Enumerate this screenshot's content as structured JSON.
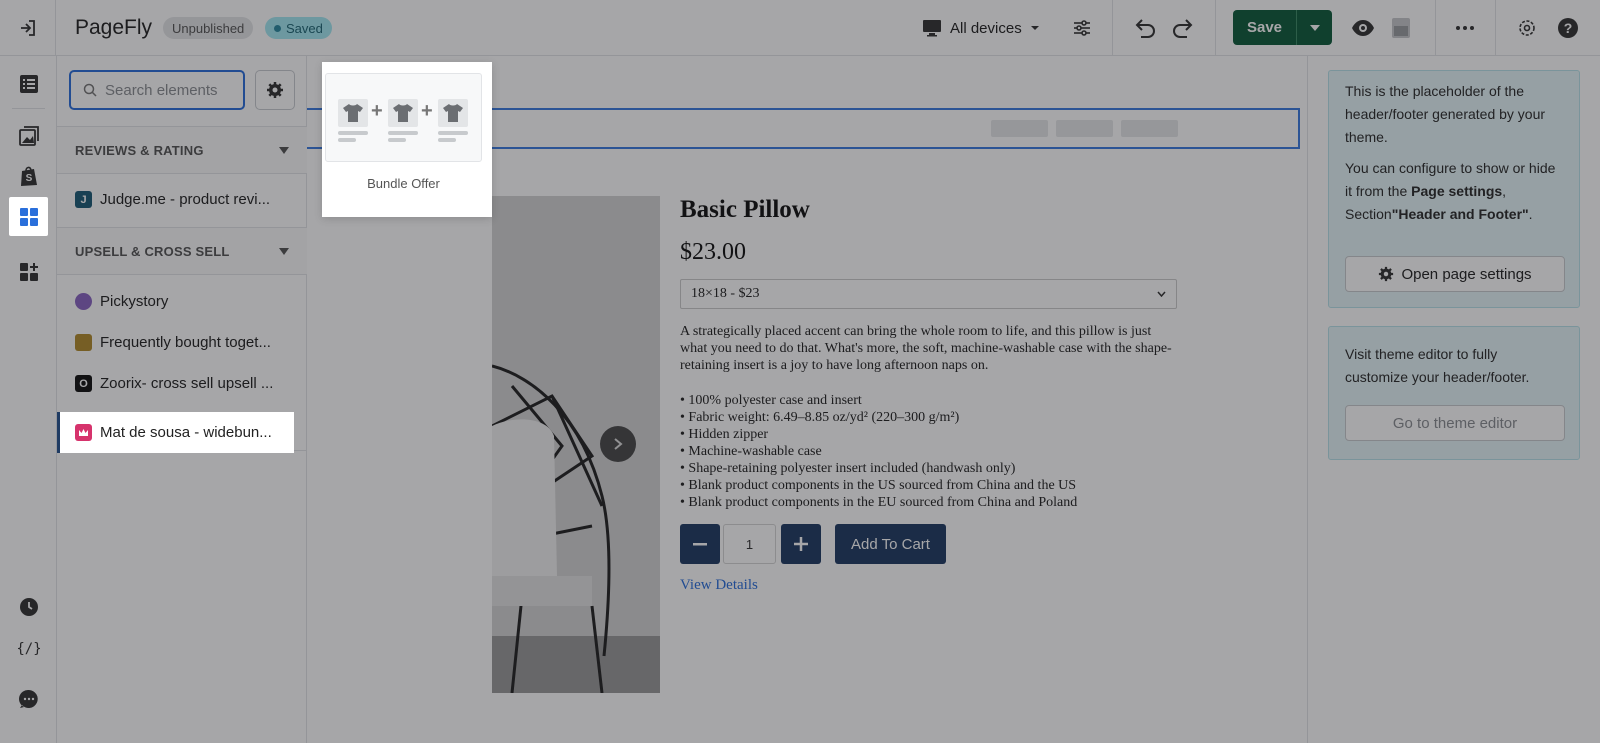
{
  "app": {
    "name": "PageFly",
    "status_unpublished": "Unpublished",
    "status_saved": "Saved"
  },
  "toolbar": {
    "devices_label": "All devices",
    "save_label": "Save"
  },
  "search": {
    "placeholder": "Search elements"
  },
  "sections": [
    {
      "title": "REVIEWS & RATING",
      "items": [
        {
          "label": "Judge.me - product revi...",
          "icon": "judgeme-icon",
          "color": "#1b5b77",
          "letter": "J"
        }
      ]
    },
    {
      "title": "UPSELL & CROSS SELL",
      "items": [
        {
          "label": "Pickystory",
          "icon": "pickystory-icon",
          "color": "#8a65c2",
          "letter": ""
        },
        {
          "label": "Frequently bought toget...",
          "icon": "frequently-bought-icon",
          "color": "#b28b2c",
          "letter": ""
        },
        {
          "label": "Zoorix- cross sell upsell ...",
          "icon": "zoorix-icon",
          "color": "#111111",
          "letter": "O"
        },
        {
          "label": "Mat de sousa - widebun...",
          "icon": "widebundle-icon",
          "color": "#d6336c",
          "letter": ""
        }
      ]
    }
  ],
  "popover": {
    "label": "Bundle Offer"
  },
  "product": {
    "title": "Basic Pillow",
    "price": "$23.00",
    "variant": "18×18 - $23",
    "description": "A strategically placed accent can bring the whole room to life, and this pillow is just what you need to do that. What's more, the soft, machine-washable case with the shape-retaining insert is a joy to have long afternoon naps on.",
    "bullets": [
      "• 100% polyester case and insert",
      "• Fabric weight: 6.49–8.85 oz/yd² (220–300 g/m²)",
      "• Hidden zipper",
      "• Machine-washable case",
      "• Shape-retaining polyester insert included (handwash only)",
      "• Blank product components in the US sourced from China and the US",
      "• Blank product components in the EU sourced from China and Poland"
    ],
    "quantity": "1",
    "add_to_cart": "Add To Cart",
    "view_details": "View Details"
  },
  "info_panel": {
    "card1_line1": "This is the placeholder of the header/footer generated by your theme.",
    "card1_line2_a": "You can configure to show or hide it from the ",
    "card1_line2_b": "Page settings",
    "card1_line2_c": ", Section",
    "card1_line2_d": "\"Header and Footer\"",
    "card1_line2_e": ".",
    "card1_button": "Open page settings",
    "card2_text": "Visit theme editor to fully customize your header/footer.",
    "card2_button": "Go to theme editor"
  },
  "colors": {
    "accent": "#2a6fdb",
    "save": "#0d5b3b",
    "navy": "#1f3b63",
    "info_bg": "#e6f6f8"
  }
}
